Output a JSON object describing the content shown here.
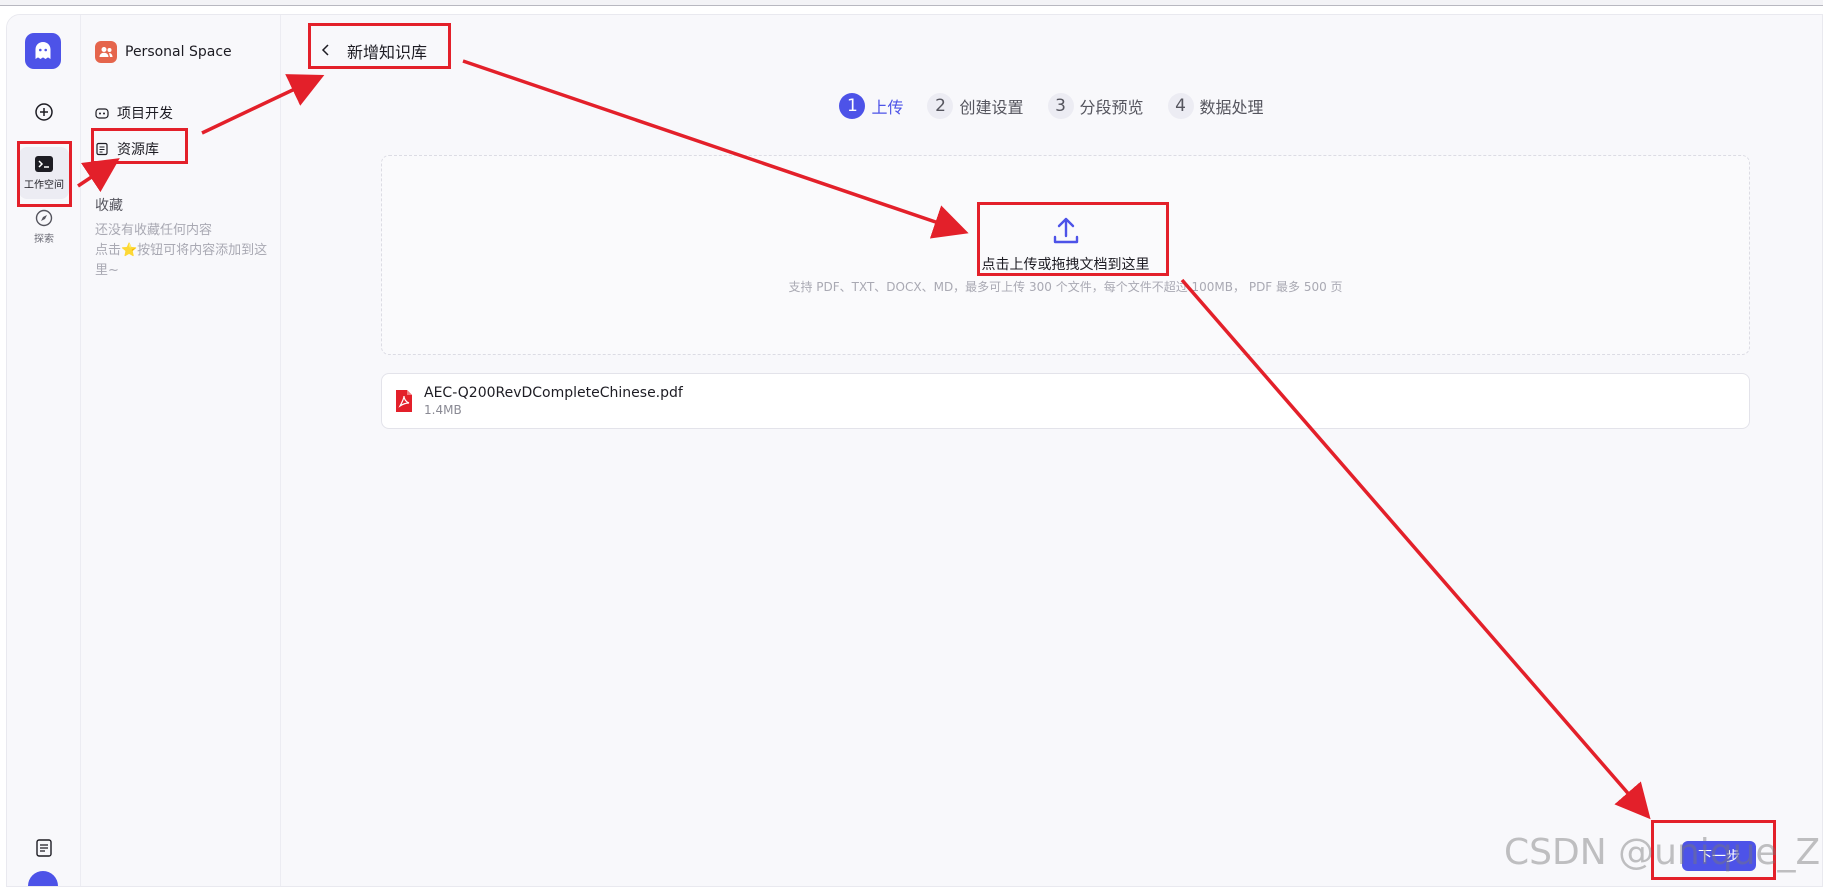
{
  "sidebar": {
    "workspace_label": "工作空间",
    "explore_label": "探索",
    "space_name": "Personal Space",
    "items": [
      {
        "label": "项目开发"
      },
      {
        "label": "资源库"
      }
    ],
    "favorites_title": "收藏",
    "favorites_empty": "还没有收藏任何内容\n点击⭐按钮可将内容添加到这里~"
  },
  "header": {
    "title": "新增知识库"
  },
  "steps": [
    {
      "num": "1",
      "label": "上传",
      "active": true
    },
    {
      "num": "2",
      "label": "创建设置"
    },
    {
      "num": "3",
      "label": "分段预览"
    },
    {
      "num": "4",
      "label": "数据处理"
    }
  ],
  "upload": {
    "text": "点击上传或拖拽文档到这里",
    "hint": "支持 PDF、TXT、DOCX、MD，最多可上传 300 个文件，每个文件不超过 100MB， PDF 最多 500 页"
  },
  "file": {
    "name": "AEC-Q200RevDCompleteChinese.pdf",
    "size": "1.4MB"
  },
  "next_button": "下一步",
  "watermark": "CSDN @unique_ZRF",
  "colors": {
    "accent": "#4d53e8",
    "annotation": "#e3202a",
    "pdf": "#e3202a"
  }
}
